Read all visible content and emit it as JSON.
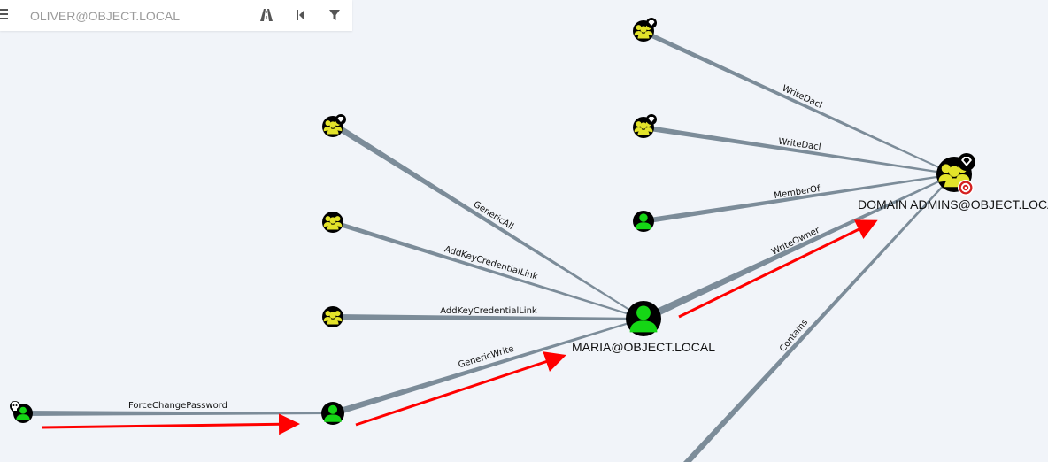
{
  "toolbar": {
    "search_placeholder": "OLIVER@OBJECT.LOCAL",
    "icons": [
      "menu-icon",
      "pathfinding-icon",
      "back-icon",
      "filter-icon"
    ]
  },
  "graph": {
    "colors": {
      "edge": "#7c8c99",
      "arrow": "#ff0000",
      "user": "#15d615",
      "group": "#e3e32a",
      "node_bg": "#000000"
    },
    "nodes": [
      {
        "id": "oliver",
        "kind": "user",
        "label": "",
        "badge": "owned-skull"
      },
      {
        "id": "victim",
        "kind": "user",
        "label": ""
      },
      {
        "id": "maria",
        "kind": "user",
        "label": "MARIA@OBJECT.LOCAL"
      },
      {
        "id": "domainadmins",
        "kind": "group",
        "label": "DOMAIN ADMINS@OBJECT.LOCAL",
        "badges": [
          "highvalue-diamond",
          "target"
        ]
      },
      {
        "id": "g-genericall",
        "kind": "group",
        "label": "",
        "badge": "highvalue-diamond"
      },
      {
        "id": "g-akcl-1",
        "kind": "group",
        "label": ""
      },
      {
        "id": "g-akcl-2",
        "kind": "group",
        "label": ""
      },
      {
        "id": "g-writedacl-1",
        "kind": "group",
        "label": "",
        "badge": "highvalue-diamond"
      },
      {
        "id": "g-writedacl-2",
        "kind": "group",
        "label": "",
        "badge": "highvalue-diamond"
      },
      {
        "id": "u-memberof",
        "kind": "user",
        "label": ""
      }
    ],
    "edges": [
      {
        "from": "oliver",
        "to": "victim",
        "label": "ForceChangePassword"
      },
      {
        "from": "victim",
        "to": "maria",
        "label": "GenericWrite"
      },
      {
        "from": "g-genericall",
        "to": "maria",
        "label": "GenericAll"
      },
      {
        "from": "g-akcl-1",
        "to": "maria",
        "label": "AddKeyCredentialLink"
      },
      {
        "from": "g-akcl-2",
        "to": "maria",
        "label": "AddKeyCredentialLink"
      },
      {
        "from": "maria",
        "to": "domainadmins",
        "label": "WriteOwner"
      },
      {
        "from": "g-writedacl-1",
        "to": "domainadmins",
        "label": "WriteDacl"
      },
      {
        "from": "g-writedacl-2",
        "to": "domainadmins",
        "label": "WriteDacl"
      },
      {
        "from": "u-memberof",
        "to": "domainadmins",
        "label": "MemberOf"
      },
      {
        "from": "offscreen-container",
        "to": "domainadmins",
        "label": "Contains"
      }
    ]
  }
}
